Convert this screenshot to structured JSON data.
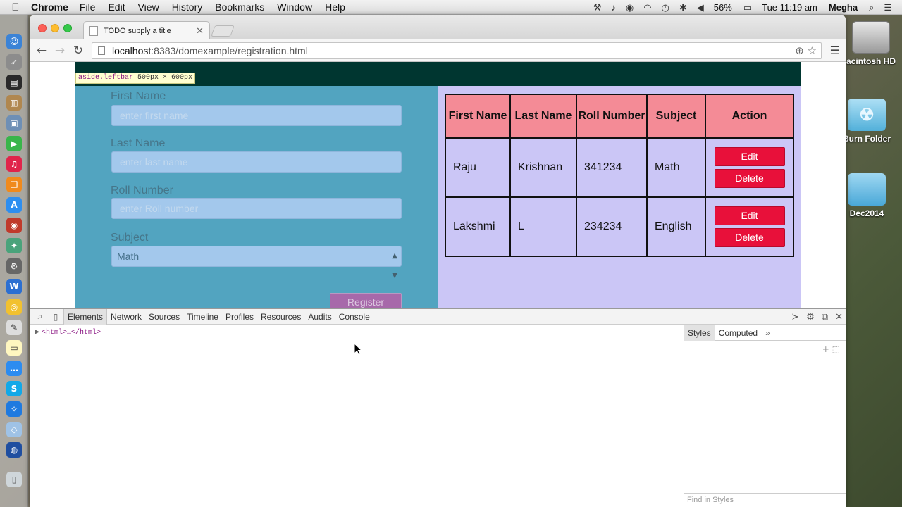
{
  "menubar": {
    "app_name": "Chrome",
    "menus": [
      "File",
      "Edit",
      "View",
      "History",
      "Bookmarks",
      "Window",
      "Help"
    ],
    "battery": "56%",
    "clock": "Tue 11:19 am",
    "user": "Megha"
  },
  "desktop": {
    "items": [
      {
        "label": "acintosh HD",
        "icon": "hard-drive-icon"
      },
      {
        "label": "Burn Folder",
        "icon": "burn-folder-icon"
      },
      {
        "label": "Dec2014",
        "icon": "folder-icon"
      }
    ]
  },
  "browser": {
    "tab_title": "TODO supply a title",
    "url_host": "localhost",
    "url_rest": ":8383/domexample/registration.html"
  },
  "page": {
    "inspect_tip": {
      "selector": "aside.leftbar",
      "dims": "500px × 600px"
    },
    "form": {
      "first_name_label": "First Name",
      "first_name_placeholder": "enter first name",
      "last_name_label": "Last Name",
      "last_name_placeholder": "enter last name",
      "roll_label": "Roll Number",
      "roll_placeholder": "enter Roll number",
      "subject_label": "Subject",
      "subject_value": "Math",
      "register_label": "Register"
    },
    "table": {
      "headers": [
        "First Name",
        "Last Name",
        "Roll Number",
        "Subject",
        "Action"
      ],
      "rows": [
        {
          "first": "Raju",
          "last": "Krishnan",
          "roll": "341234",
          "subject": "Math"
        },
        {
          "first": "Lakshmi",
          "last": "L",
          "roll": "234234",
          "subject": "English"
        }
      ],
      "edit_label": "Edit",
      "delete_label": "Delete"
    },
    "colors": {
      "header": "#003630",
      "leftbar": "#52a4c0",
      "rightbar": "#cbc6f6",
      "table_header": "#f48b96",
      "action_button": "#e8103a",
      "register_button": "#a769aa"
    }
  },
  "devtools": {
    "tabs": [
      "Elements",
      "Network",
      "Sources",
      "Timeline",
      "Profiles",
      "Resources",
      "Audits",
      "Console"
    ],
    "dom_root": "<html>…</html>",
    "styles_tabs": [
      "Styles",
      "Computed"
    ],
    "find_placeholder": "Find in Styles"
  }
}
